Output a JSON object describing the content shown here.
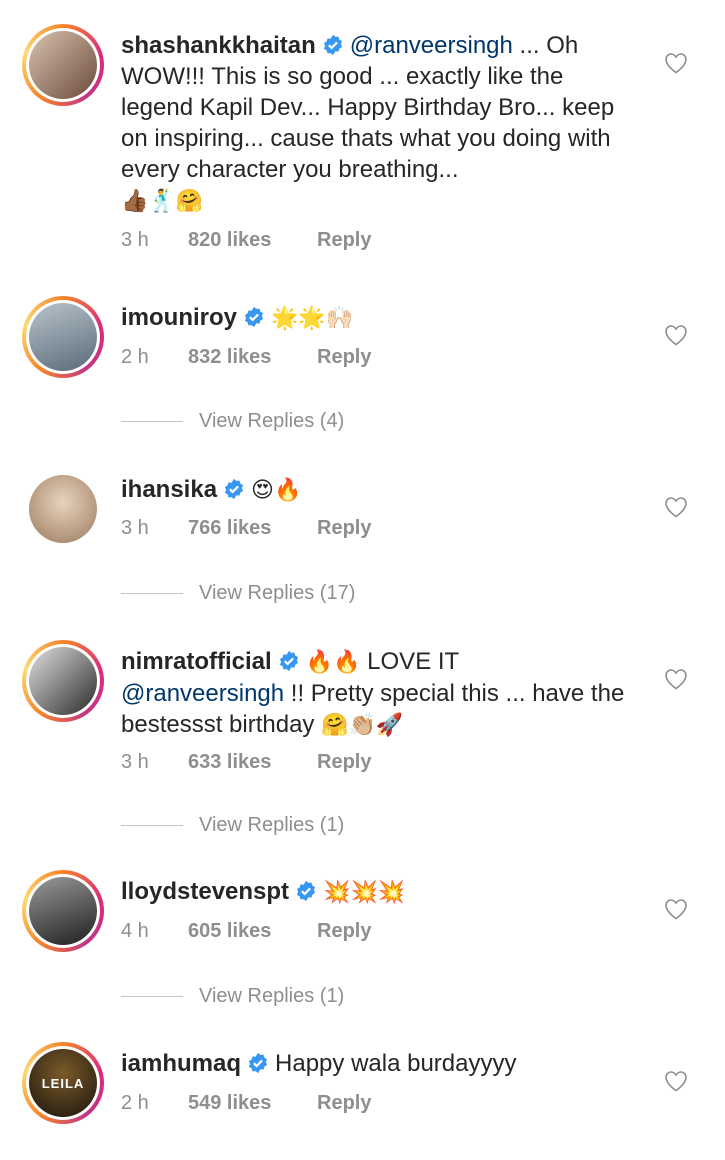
{
  "comments": [
    {
      "username": "shashankkhaitan",
      "mention": "@ranveersingh",
      "text": " ... Oh WOW!!! This is so good ... exactly like the legend Kapil Dev... Happy Birthday Bro... keep on inspiring... cause thats what you doing with every character you breathing...",
      "emojis": "👍🏾🕺🤗",
      "time": "3 h",
      "likes": "820 likes",
      "reply": "Reply",
      "avatar_color": "#6b4a3a",
      "view_replies": ""
    },
    {
      "username": "imouniroy",
      "mention": "",
      "text": "",
      "emojis": "🌟🌟🙌🏻",
      "time": "2 h",
      "likes": "832 likes",
      "reply": "Reply",
      "avatar_color": "#8a9aa8",
      "view_replies": "View Replies (4)"
    },
    {
      "username": "ihansika",
      "mention": "",
      "text": "",
      "emojis": "😍🔥",
      "time": "3 h",
      "likes": "766 likes",
      "reply": "Reply",
      "avatar_color": "#c9a98a",
      "view_replies": "View Replies (17)"
    },
    {
      "username": "nimratofficial",
      "mention": "@ranveersingh",
      "prefix_emojis": "🔥🔥",
      "prefix_text": " LOVE IT",
      "text": " !! Pretty special this ... have the bestessst birthday ",
      "emojis": "🤗👏🏼🚀",
      "time": "3 h",
      "likes": "633 likes",
      "reply": "Reply",
      "avatar_color": "#4a4a4a",
      "view_replies": "View Replies (1)"
    },
    {
      "username": "lloydstevenspt",
      "mention": "",
      "text": "",
      "emojis": "💥💥💥",
      "time": "4 h",
      "likes": "605 likes",
      "reply": "Reply",
      "avatar_color": "#3a3a3a",
      "view_replies": "View Replies (1)"
    },
    {
      "username": "iamhumaq",
      "mention": "",
      "text": "Happy wala burdayyyy",
      "emojis": "",
      "time": "2 h",
      "likes": "549 likes",
      "reply": "Reply",
      "avatar_color": "#2a2418",
      "avatar_text": "LEILA",
      "view_replies": ""
    }
  ],
  "colors": {
    "verified": "#3897f0",
    "mention": "#00376b",
    "meta": "#8e8e8e"
  },
  "icons": {
    "verified": "verified-badge-icon",
    "like": "heart-outline-icon"
  }
}
